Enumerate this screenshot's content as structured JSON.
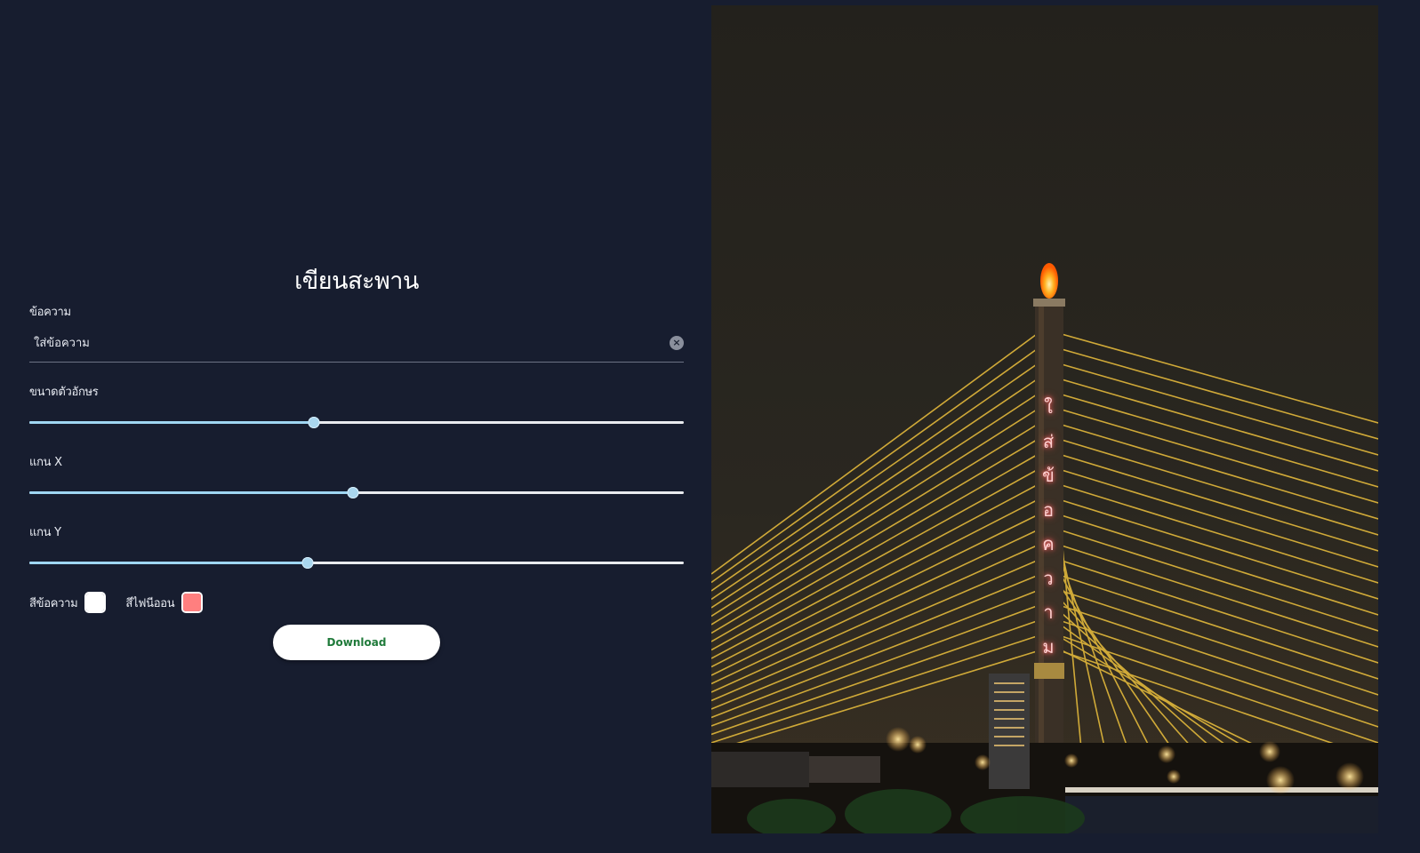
{
  "app": {
    "title": "เขียนสะพาน"
  },
  "message_field": {
    "label": "ข้อความ",
    "value": "",
    "placeholder": "ใส่ข้อความ"
  },
  "sliders": {
    "font_size": {
      "label": "ขนาดตัวอักษร",
      "value_percent": 43.5
    },
    "axis_x": {
      "label": "แกน X",
      "value_percent": 49.5
    },
    "axis_y": {
      "label": "แกน Y",
      "value_percent": 42.5
    }
  },
  "colors": {
    "text_color": {
      "label": "สีข้อความ",
      "value": "#ffffff"
    },
    "neon_color": {
      "label": "สีไฟนีออน",
      "value": "#ff7f7f"
    }
  },
  "download_button": {
    "label": "Download"
  },
  "preview": {
    "overlay_chars": [
      "ใ",
      "ส่",
      "ข้",
      "อ",
      "ค",
      "ว",
      "า",
      "ม"
    ]
  },
  "theme": {
    "background": "#171d2f",
    "slider_fill": "#9fd6f2",
    "button_text": "#1f7a3a"
  },
  "icons": {
    "clear": "close-circle-icon"
  }
}
